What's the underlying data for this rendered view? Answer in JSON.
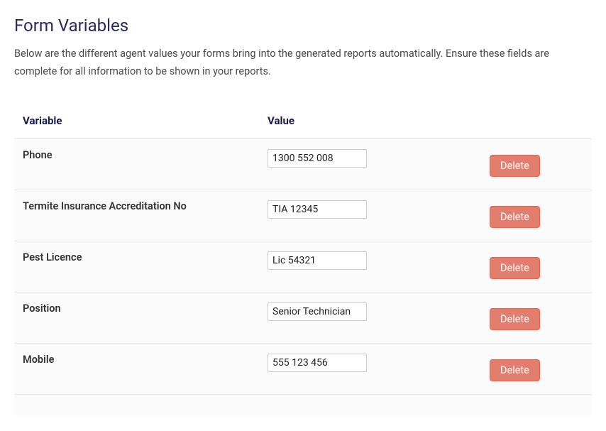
{
  "page_title": "Form Variables",
  "description": "Below are the different agent values your forms bring into the generated reports automatically. Ensure these fields are complete for all information to be shown in your reports.",
  "table": {
    "headers": {
      "variable": "Variable",
      "value": "Value"
    },
    "rows": [
      {
        "variable": "Phone",
        "value": "1300 552 008"
      },
      {
        "variable": "Termite Insurance Accreditation No",
        "value": "TIA 12345"
      },
      {
        "variable": "Pest Licence",
        "value": "Lic 54321"
      },
      {
        "variable": "Position",
        "value": "Senior Technician"
      },
      {
        "variable": "Mobile",
        "value": "555 123 456"
      }
    ]
  },
  "delete_label": "Delete"
}
